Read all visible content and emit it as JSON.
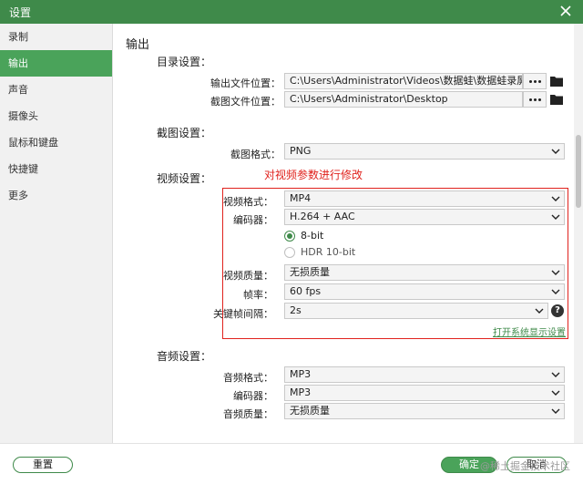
{
  "window": {
    "title": "设置"
  },
  "sidebar": {
    "items": [
      {
        "label": "录制"
      },
      {
        "label": "输出"
      },
      {
        "label": "声音"
      },
      {
        "label": "摄像头"
      },
      {
        "label": "鼠标和键盘"
      },
      {
        "label": "快捷键"
      },
      {
        "label": "更多"
      }
    ],
    "active_index": 1
  },
  "main": {
    "heading": "输出",
    "directory": {
      "title": "目录设置：",
      "output_folder_label": "输出文件位置：",
      "output_folder_value": "C:\\Users\\Administrator\\Videos\\数据蛙\\数据蛙录屏软件",
      "screenshot_folder_label": "截图文件位置：",
      "screenshot_folder_value": "C:\\Users\\Administrator\\Desktop"
    },
    "screenshot": {
      "title": "截图设置：",
      "format_label": "截图格式：",
      "format_value": "PNG"
    },
    "video": {
      "title": "视频设置：",
      "annotation": "对视频参数进行修改",
      "format_label": "视频格式：",
      "format_value": "MP4",
      "encoder_label": "编码器：",
      "encoder_value": "H.264 + AAC",
      "bitdepth_options": [
        "8-bit",
        "HDR 10-bit"
      ],
      "bitdepth_selected": "8-bit",
      "quality_label": "视频质量：",
      "quality_value": "无损质量",
      "fps_label": "帧率：",
      "fps_value": "60 fps",
      "keyframe_label": "关键帧间隔：",
      "keyframe_value": "2s",
      "display_link": "打开系统显示设置"
    },
    "audio": {
      "title": "音频设置：",
      "format_label": "音频格式：",
      "format_value": "MP3",
      "encoder_label": "编码器：",
      "encoder_value": "MP3",
      "quality_label": "音频质量：",
      "quality_value": "无损质量"
    }
  },
  "footer": {
    "reset_label": "重置",
    "ok_label": "确定",
    "cancel_label": "取消",
    "watermark": "@稀土掘金技术社区"
  },
  "colors": {
    "accent": "#4aa35a",
    "annotation": "#e0221d"
  }
}
